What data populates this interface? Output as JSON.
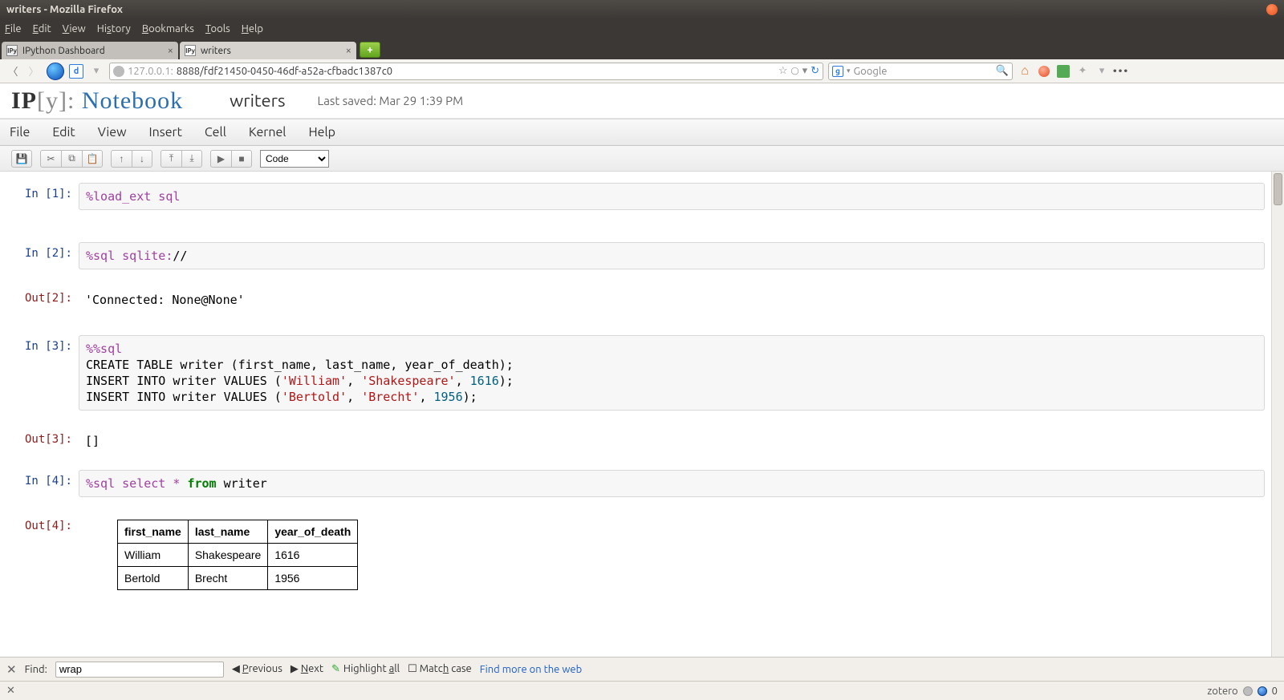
{
  "window": {
    "title": "writers - Mozilla Firefox"
  },
  "firefox_menu": [
    "File",
    "Edit",
    "View",
    "History",
    "Bookmarks",
    "Tools",
    "Help"
  ],
  "tabs": [
    {
      "favicon": "IPy",
      "label": "IPython Dashboard",
      "active": false
    },
    {
      "favicon": "IPy",
      "label": "writers",
      "active": true
    }
  ],
  "url": {
    "host": "127.0.0.1:",
    "port_path": "8888/fdf21450-0450-46df-a52a-cfbadc1387c0"
  },
  "search": {
    "placeholder": "Google"
  },
  "notebook": {
    "logo_ip": "IP",
    "logo_y": "[y]:",
    "logo_nb": " Notebook",
    "title": "writers",
    "saved": "Last saved: Mar 29 1:39 PM",
    "menu": [
      "File",
      "Edit",
      "View",
      "Insert",
      "Cell",
      "Kernel",
      "Help"
    ],
    "celltype": "Code"
  },
  "cells": {
    "c1": {
      "in": "In [1]:",
      "text": "%load_ext sql"
    },
    "c2": {
      "in": "In [2]:",
      "text_a": "%sql sqlite:",
      "text_b": "//",
      "out_prompt": "Out[2]:",
      "out_text": "'Connected: None@None'"
    },
    "c3": {
      "in": "In [3]:",
      "l1a": "%%sql",
      "l2a": "CREATE TABLE writer (first_name, last_name, year_of_death);",
      "l3a": "INSERT INTO writer VALUES (",
      "l3s1": "'William'",
      "l3c": ", ",
      "l3s2": "'Shakespeare'",
      "l3d": ", ",
      "l3n": "1616",
      "l3e": ");",
      "l4a": "INSERT INTO writer VALUES (",
      "l4s1": "'Bertold'",
      "l4c": ", ",
      "l4s2": "'Brecht'",
      "l4d": ", ",
      "l4n": "1956",
      "l4e": ");",
      "out_prompt": "Out[3]:",
      "out_text": "[]"
    },
    "c4": {
      "in": "In [4]:",
      "a": "%sql select ",
      "star": "*",
      "b": " ",
      "kw": "from",
      "c": " writer",
      "out_prompt": "Out[4]:"
    }
  },
  "table": {
    "headers": [
      "first_name",
      "last_name",
      "year_of_death"
    ],
    "rows": [
      [
        "William",
        "Shakespeare",
        "1616"
      ],
      [
        "Bertold",
        "Brecht",
        "1956"
      ]
    ]
  },
  "findbar": {
    "label": "Find:",
    "value": "wrap",
    "prev": "Previous",
    "next": "Next",
    "highlight": "Highlight all",
    "matchcase": "Match case",
    "more": "Find more on the web"
  },
  "statusbar": {
    "zotero": "zotero",
    "count": "0"
  }
}
